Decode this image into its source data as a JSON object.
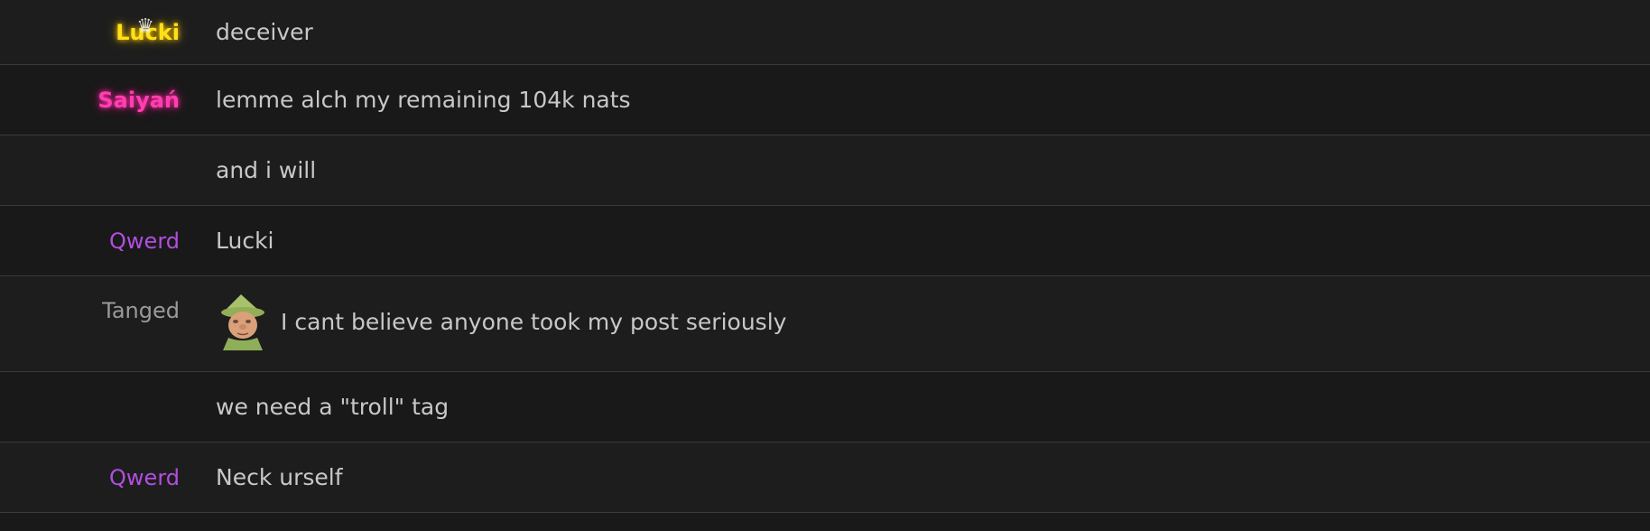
{
  "messages": [
    {
      "user": "Lucki",
      "text": "deceiver"
    },
    {
      "user": "Saiyań",
      "text": "lemme alch my remaining 104k nats"
    },
    {
      "user": "",
      "text": "and i will"
    },
    {
      "user": "Qwerd",
      "text": "Lucki"
    },
    {
      "user": "Tanged",
      "text": "I cant believe anyone took my post seriously",
      "emote": "gnome-child-emote"
    },
    {
      "user": "",
      "text": "we need a \"troll\" tag"
    },
    {
      "user": "Qwerd",
      "text": "Neck urself"
    }
  ],
  "colors": {
    "gold_name": "#ffe01a",
    "pink_name": "#ff3fb0",
    "purple_name": "#b24ee0",
    "grey_name": "#9a9a9a",
    "message_text": "#c8c8c8"
  }
}
